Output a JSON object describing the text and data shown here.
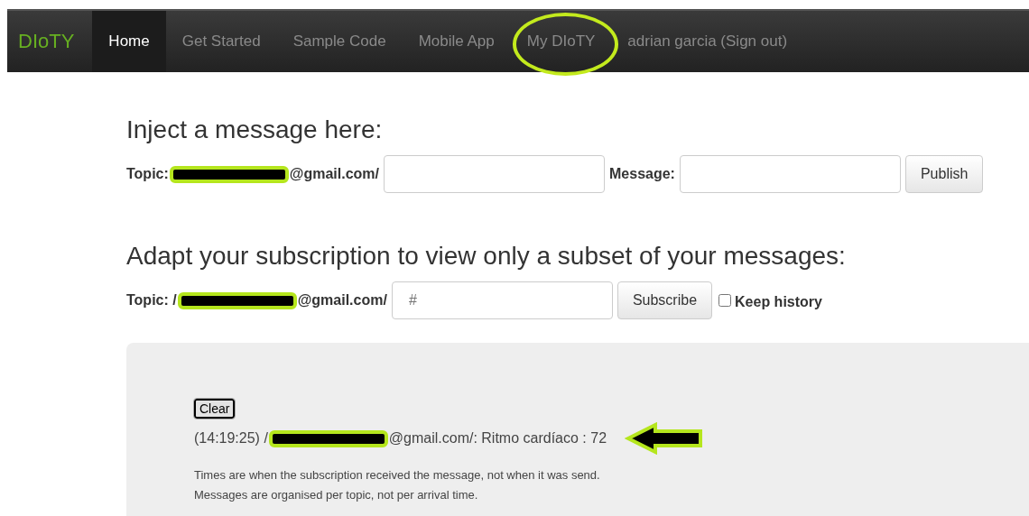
{
  "navbar": {
    "brand": "DIoTY",
    "items": [
      {
        "label": "Home",
        "selected": true,
        "circled": false
      },
      {
        "label": "Get Started",
        "selected": false,
        "circled": false
      },
      {
        "label": "Sample Code",
        "selected": false,
        "circled": false
      },
      {
        "label": "Mobile App",
        "selected": false,
        "circled": false
      },
      {
        "label": "My DIoTY",
        "selected": false,
        "circled": true
      },
      {
        "label": "adrian garcia (Sign out)",
        "selected": false,
        "circled": false
      }
    ]
  },
  "inject": {
    "heading": "Inject a message here:",
    "topic_label": "Topic:",
    "topic_suffix": "@gmail.com/",
    "message_label": "Message:",
    "button": "Publish"
  },
  "subscription": {
    "heading": "Adapt your subscription to view only a subset of your messages:",
    "topic_label": "Topic: /",
    "topic_suffix": "@gmail.com/",
    "topic_placeholder": "#",
    "button": "Subscribe",
    "keep_history": {
      "label": "Keep history",
      "checked": false
    }
  },
  "messages": {
    "clear_button": "Clear",
    "entries": [
      {
        "prefix": "(14:19:25) /",
        "suffix": "@gmail.com/: Ritmo cardíaco : 72"
      }
    ],
    "notes": [
      "Times are when the subscription received the message, not when it was send.",
      "Messages are organised per topic, not per arrival time."
    ]
  }
}
